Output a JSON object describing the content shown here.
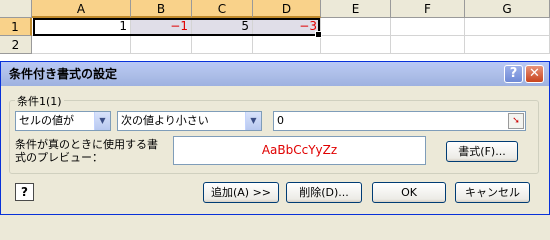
{
  "sheet": {
    "columns": [
      "A",
      "B",
      "C",
      "D",
      "E",
      "F",
      "G"
    ],
    "rows": [
      "1",
      "2"
    ],
    "row1": [
      "1",
      "−1",
      "5",
      "−3",
      "",
      "",
      ""
    ]
  },
  "dialog": {
    "title": "条件付き書式の設定",
    "help_btn": "?",
    "close_btn": "✕",
    "condition_label": "条件1(1)",
    "condition_type": "セルの値が",
    "operator": "次の値より小さい",
    "value": "0",
    "preview_label": "条件が真のときに使用する書式のプレビュー：",
    "preview_text": "AaBbCcYyZz",
    "format_button": "書式(F)...",
    "add_button": "追加(A) >>",
    "delete_button": "削除(D)...",
    "ok_button": "OK",
    "cancel_button": "キャンセル",
    "help_icon": "?"
  },
  "colors": {
    "negative": "#e00000",
    "title_bar": "#aebfe8"
  }
}
